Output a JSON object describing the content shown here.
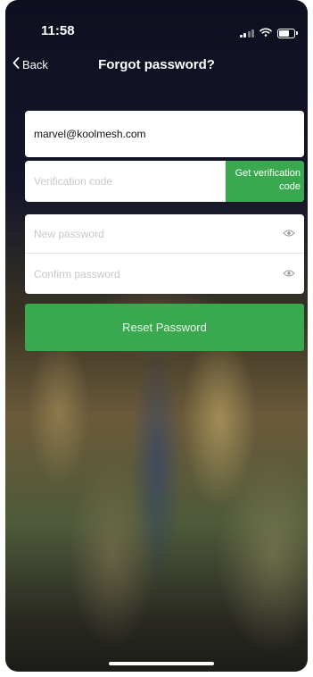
{
  "status_bar": {
    "time": "11:58"
  },
  "nav": {
    "back_label": "Back",
    "title": "Forgot password?"
  },
  "form": {
    "email_value": "marvel@koolmesh.com",
    "verification_placeholder": "Verification code",
    "get_code_label": "Get verification code",
    "new_password_placeholder": "New password",
    "confirm_password_placeholder": "Confirm password",
    "reset_label": "Reset Password"
  },
  "colors": {
    "accent": "#3aa84e"
  },
  "icons": [
    "chevron-left-icon",
    "eye-icon",
    "signal-icon",
    "wifi-icon",
    "battery-icon"
  ]
}
